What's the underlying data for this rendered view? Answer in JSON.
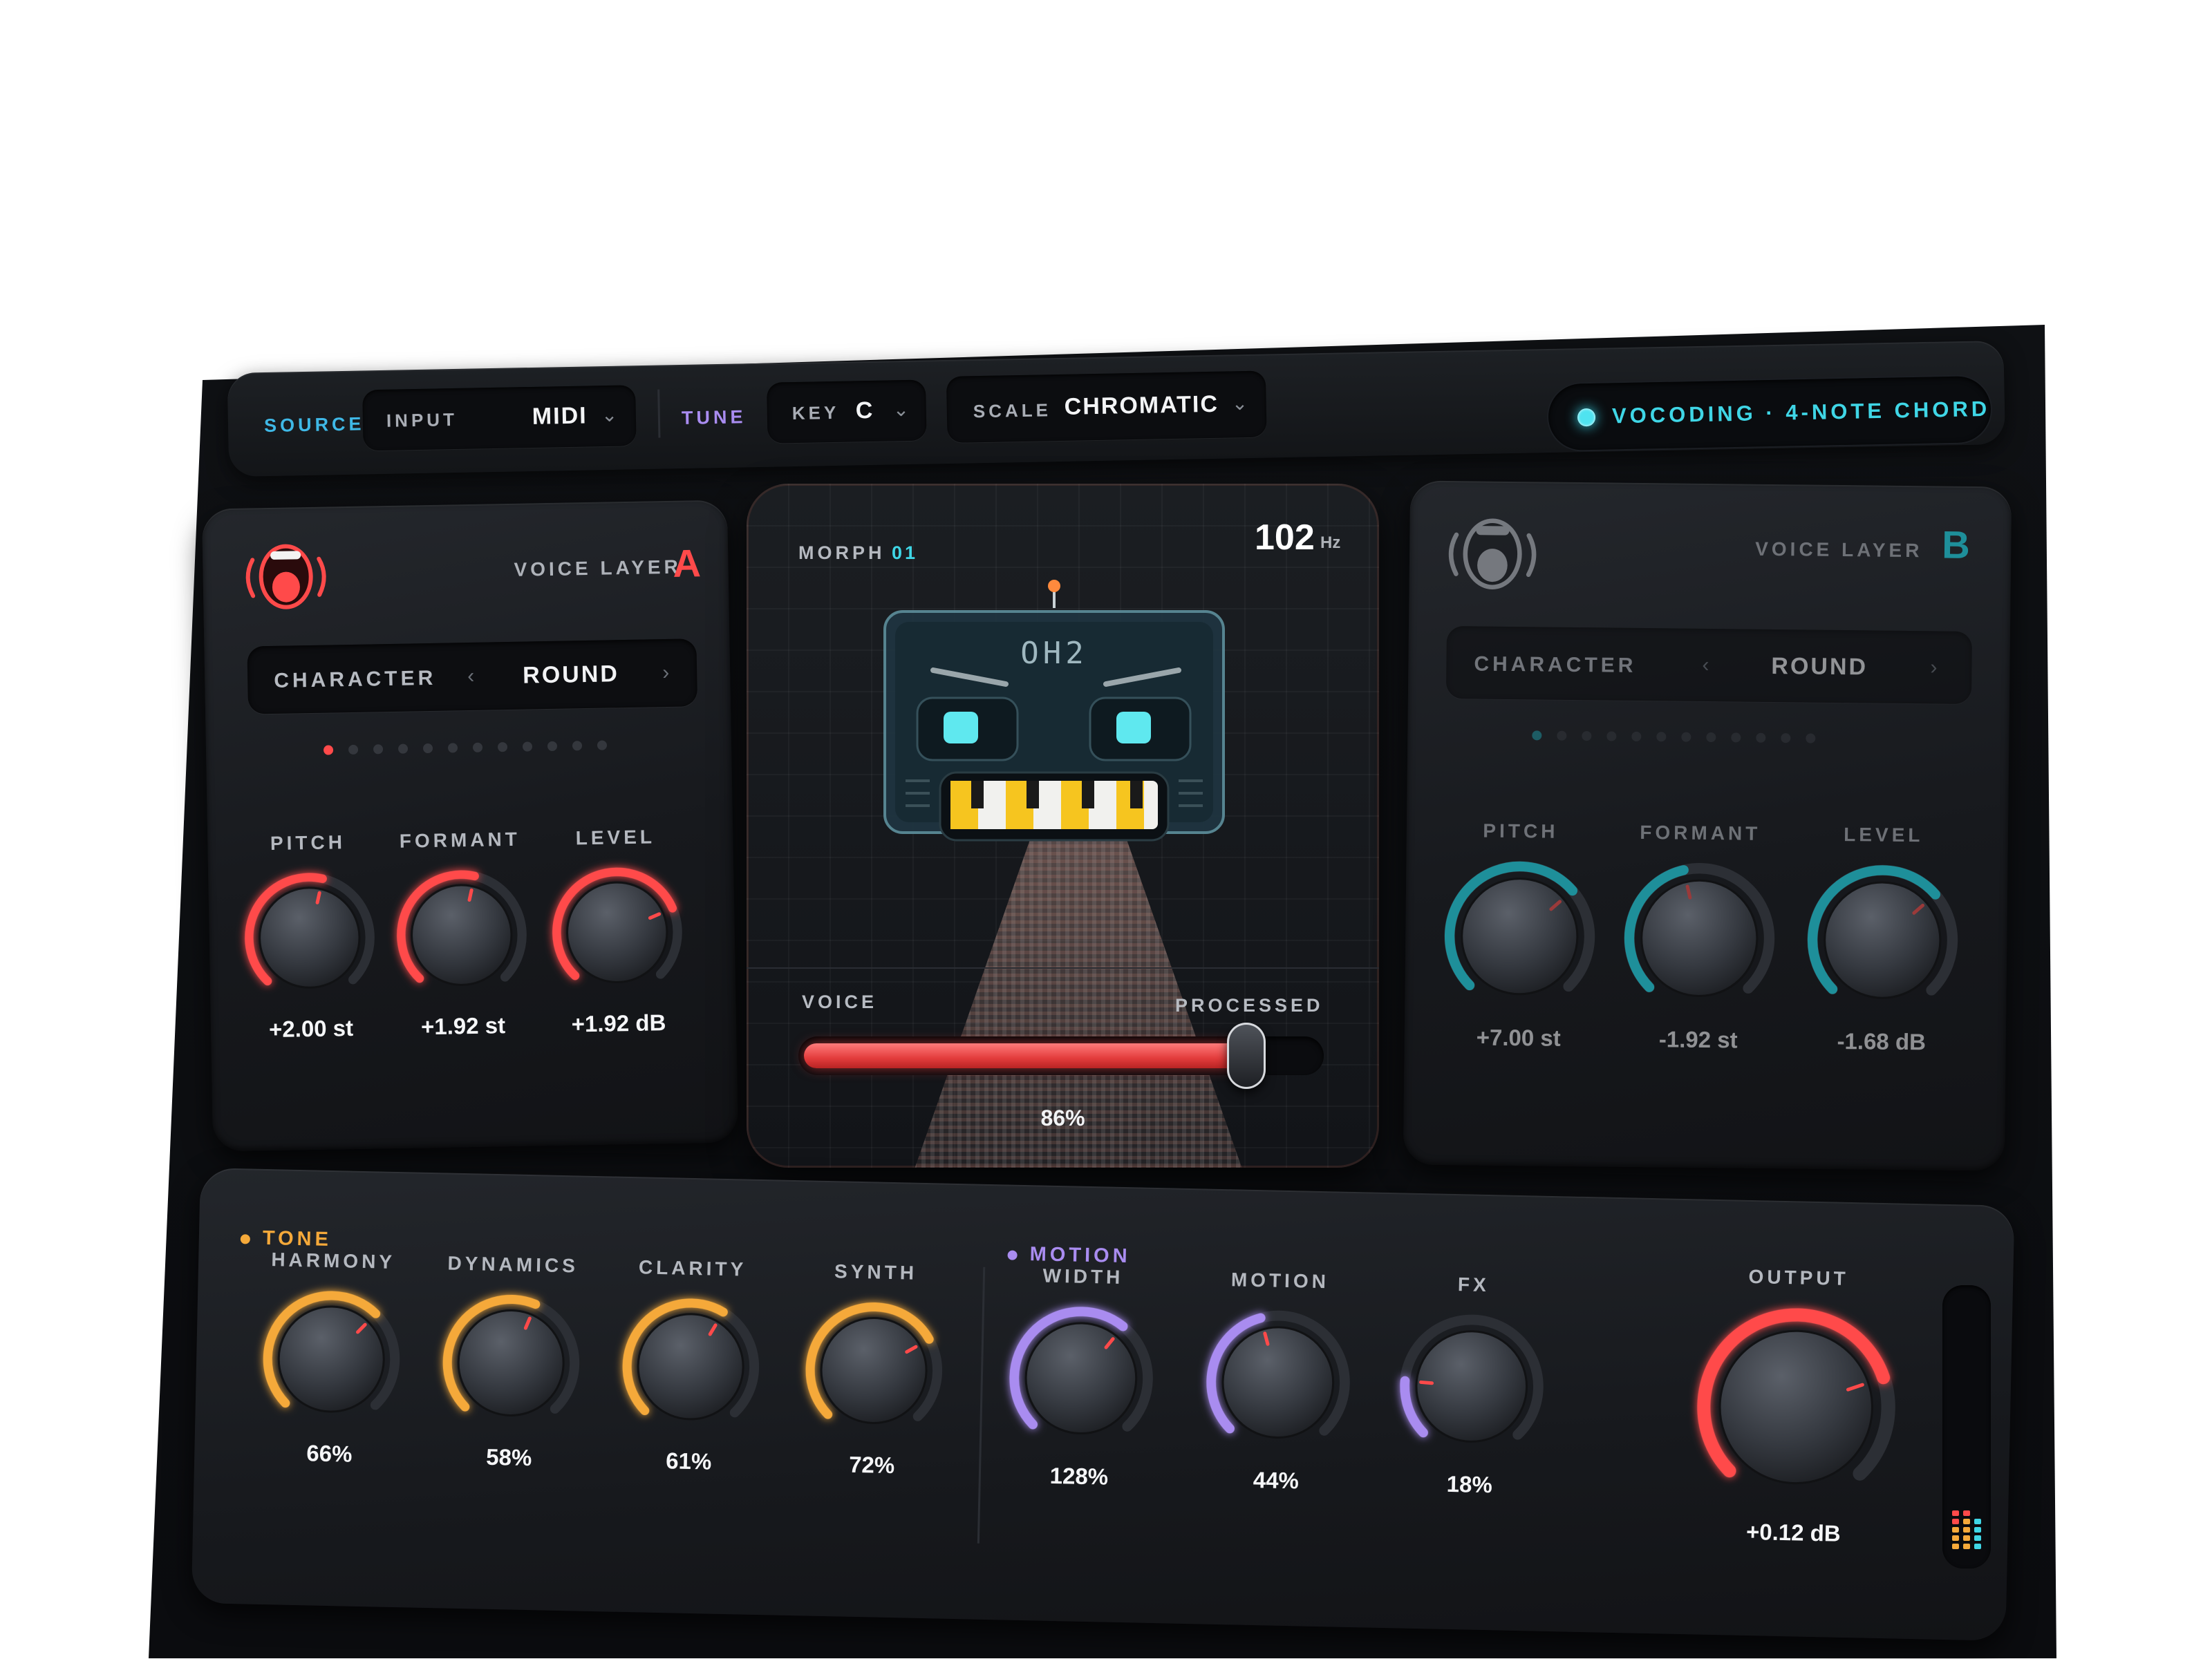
{
  "topbar": {
    "source_label": "SOURCE",
    "input_key": "INPUT",
    "input_value": "MIDI",
    "tune_label": "TUNE",
    "key_key": "KEY",
    "key_value": "C",
    "scale_key": "SCALE",
    "scale_value": "CHROMATIC",
    "status": "VOCODING · 4-NOTE CHORD"
  },
  "layer_a": {
    "title": "VOICE LAYER",
    "letter": "A",
    "character_label": "CHARACTER",
    "character_value": "ROUND",
    "preset_index": 1,
    "preset_count": 12,
    "knobs": [
      {
        "label": "PITCH",
        "value": "+2.00 st",
        "fraction": 0.55
      },
      {
        "label": "FORMANT",
        "value": "+1.92 st",
        "fraction": 0.55
      },
      {
        "label": "LEVEL",
        "value": "+1.92 dB",
        "fraction": 0.75
      }
    ]
  },
  "layer_b": {
    "title": "VOICE LAYER",
    "letter": "B",
    "character_label": "CHARACTER",
    "character_value": "ROUND",
    "preset_index": 1,
    "preset_count": 12,
    "knobs": [
      {
        "label": "PITCH",
        "value": "+7.00 st",
        "fraction": 0.68
      },
      {
        "label": "FORMANT",
        "value": "-1.92 st",
        "fraction": 0.45
      },
      {
        "label": "LEVEL",
        "value": "-1.68 dB",
        "fraction": 0.68
      }
    ]
  },
  "morph": {
    "label": "MORPH",
    "number": "01",
    "freq": "102",
    "freq_unit": "Hz",
    "display": "OH2",
    "left_label": "VOICE",
    "right_label": "PROCESSED",
    "value": "86%",
    "fraction": 0.86
  },
  "tone": {
    "title": "TONE",
    "knobs": [
      {
        "label": "HARMONY",
        "value": "66%",
        "fraction": 0.66
      },
      {
        "label": "DYNAMICS",
        "value": "58%",
        "fraction": 0.58
      },
      {
        "label": "CLARITY",
        "value": "61%",
        "fraction": 0.61
      },
      {
        "label": "SYNTH",
        "value": "72%",
        "fraction": 0.72
      }
    ]
  },
  "motion": {
    "title": "MOTION",
    "knobs": [
      {
        "label": "WIDTH",
        "value": "128%",
        "fraction": 0.64
      },
      {
        "label": "MOTION",
        "value": "44%",
        "fraction": 0.44
      },
      {
        "label": "FX",
        "value": "18%",
        "fraction": 0.18
      }
    ]
  },
  "output": {
    "label": "OUTPUT",
    "value": "+0.12 dB",
    "fraction": 0.76
  },
  "colors": {
    "cyan": "#3fd6e6",
    "red": "#ff4a4a",
    "orange": "#f5a93a",
    "purple": "#a98cf0",
    "teal": "#1e8f9a"
  }
}
